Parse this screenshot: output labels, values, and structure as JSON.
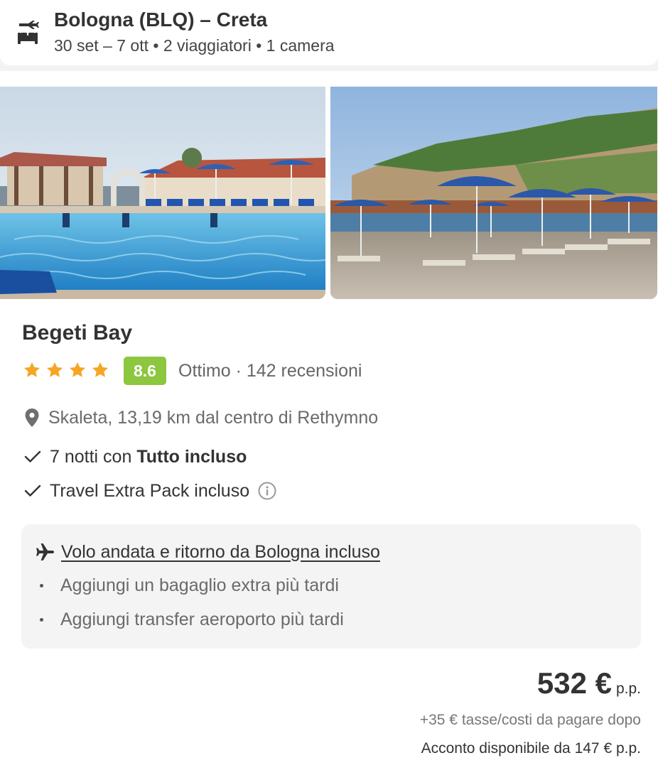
{
  "header": {
    "title": "Bologna (BLQ) – Creta",
    "subtitle": "30 set – 7 ott • 2 viaggiatori • 1 camera",
    "icon": "flight-hotel-icon"
  },
  "hotel": {
    "name": "Begeti Bay",
    "stars": 4,
    "score": "8.6",
    "rating_text": "Ottimo · 142 recensioni",
    "location": "Skaleta, 13,19 km dal centro di Rethymno",
    "features": [
      {
        "prefix": "7 notti con ",
        "bold": "Tutto incluso",
        "suffix": ""
      },
      {
        "prefix": "Travel Extra Pack incluso",
        "bold": "",
        "suffix": ""
      }
    ],
    "photos": [
      "pool-photo",
      "beach-photo"
    ]
  },
  "flight": {
    "title": "Volo andata e ritorno da Bologna incluso",
    "items": [
      "Aggiungi un bagaglio extra più tardi",
      "Aggiungi transfer aeroporto più tardi"
    ]
  },
  "pricing": {
    "price": "532 €",
    "unit": "p.p.",
    "taxes": "+35 € tasse/costi da pagare dopo",
    "deposit": "Acconto disponibile da 147 € p.p."
  },
  "colors": {
    "score_badge": "#8dc63f",
    "star": "#f5a623",
    "text_primary": "#333333",
    "text_muted": "#6a6a6a",
    "box_bg": "#f4f4f4"
  }
}
